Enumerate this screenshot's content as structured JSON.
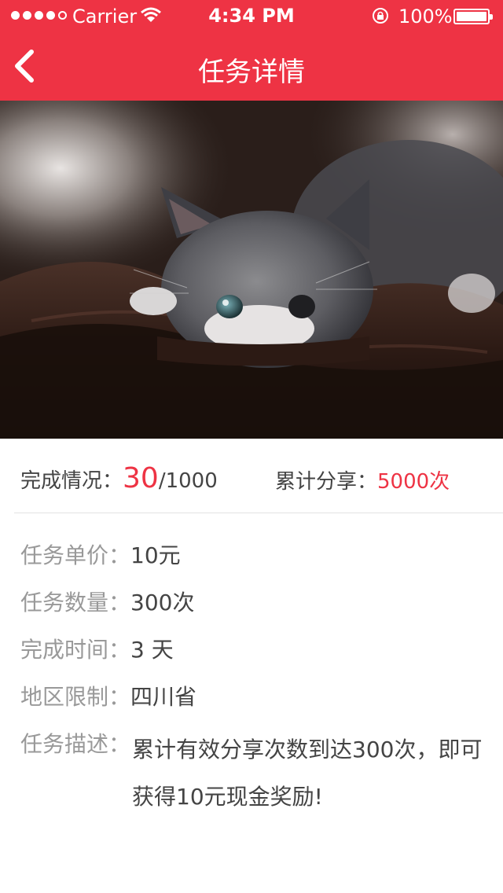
{
  "status_bar": {
    "carrier": "Carrier",
    "time": "4:34 PM",
    "battery": "100%",
    "signal_bars_filled": 4,
    "signal_bars_total": 5,
    "battery_level": 1.0
  },
  "nav": {
    "title": "任务详情",
    "back_icon": "chevron-left-icon"
  },
  "hero": {
    "image": "kitten-photo"
  },
  "summary": {
    "completion_label": "完成情况：",
    "completion_done": "30",
    "completion_total": "/1000",
    "share_label": "累计分享：",
    "share_value": "5000次"
  },
  "details": {
    "price_label": "任务单价",
    "price_value": "10元",
    "quantity_label": "任务数量",
    "quantity_value": "300次",
    "duration_label": "完成时间",
    "duration_value": "3 天",
    "region_label": "地区限制",
    "region_value": "四川省",
    "description_label": "任务描述",
    "description_value": "累计有效分享次数到达300次，即可获得10元现金奖励!",
    "colon": "："
  },
  "colors": {
    "accent": "#ee3344",
    "label": "#999999",
    "value": "#444444"
  }
}
